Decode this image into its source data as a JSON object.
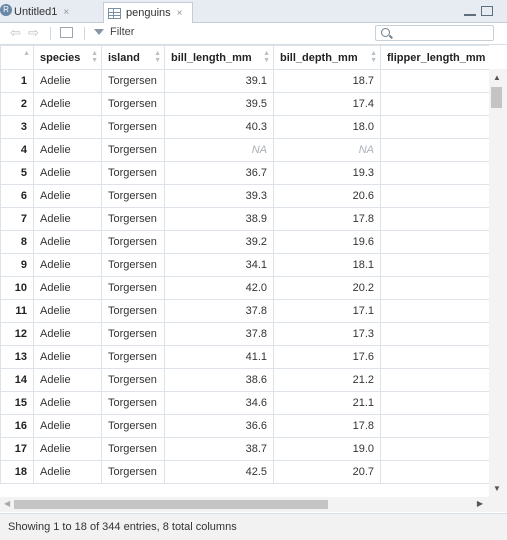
{
  "tabs": [
    {
      "label": "Untitled1",
      "close": "×"
    },
    {
      "label": "penguins",
      "close": "×"
    }
  ],
  "toolbar": {
    "filter_label": "Filter",
    "search_placeholder": ""
  },
  "table": {
    "columns": [
      "species",
      "island",
      "bill_length_mm",
      "bill_depth_mm",
      "flipper_length_mm"
    ],
    "rows": [
      [
        "1",
        "Adelie",
        "Torgersen",
        "39.1",
        "18.7"
      ],
      [
        "2",
        "Adelie",
        "Torgersen",
        "39.5",
        "17.4"
      ],
      [
        "3",
        "Adelie",
        "Torgersen",
        "40.3",
        "18.0"
      ],
      [
        "4",
        "Adelie",
        "Torgersen",
        "NA",
        "NA"
      ],
      [
        "5",
        "Adelie",
        "Torgersen",
        "36.7",
        "19.3"
      ],
      [
        "6",
        "Adelie",
        "Torgersen",
        "39.3",
        "20.6"
      ],
      [
        "7",
        "Adelie",
        "Torgersen",
        "38.9",
        "17.8"
      ],
      [
        "8",
        "Adelie",
        "Torgersen",
        "39.2",
        "19.6"
      ],
      [
        "9",
        "Adelie",
        "Torgersen",
        "34.1",
        "18.1"
      ],
      [
        "10",
        "Adelie",
        "Torgersen",
        "42.0",
        "20.2"
      ],
      [
        "11",
        "Adelie",
        "Torgersen",
        "37.8",
        "17.1"
      ],
      [
        "12",
        "Adelie",
        "Torgersen",
        "37.8",
        "17.3"
      ],
      [
        "13",
        "Adelie",
        "Torgersen",
        "41.1",
        "17.6"
      ],
      [
        "14",
        "Adelie",
        "Torgersen",
        "38.6",
        "21.2"
      ],
      [
        "15",
        "Adelie",
        "Torgersen",
        "34.6",
        "21.1"
      ],
      [
        "16",
        "Adelie",
        "Torgersen",
        "36.6",
        "17.8"
      ],
      [
        "17",
        "Adelie",
        "Torgersen",
        "38.7",
        "19.0"
      ],
      [
        "18",
        "Adelie",
        "Torgersen",
        "42.5",
        "20.7"
      ]
    ]
  },
  "status": "Showing 1 to 18 of 344 entries, 8 total columns"
}
